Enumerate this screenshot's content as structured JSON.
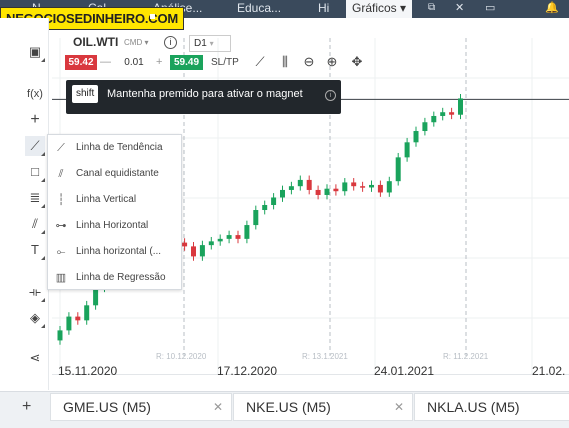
{
  "brand": {
    "logo_text": "NEGOCIOSEDINHEIRO.COM"
  },
  "nav": {
    "tabs": [
      {
        "label": "N"
      },
      {
        "label": "Cal"
      },
      {
        "label": "Análise..."
      },
      {
        "label": "Educa..."
      },
      {
        "label": "Hi"
      },
      {
        "label": "Gráficos"
      }
    ],
    "active": "Gráficos"
  },
  "instrument": {
    "symbol": "OIL.WTI",
    "type": "CMD",
    "interval": "D1",
    "sell_price": "59.42",
    "quantity": "0.01",
    "buy_price": "59.49",
    "sltp_label": "SL/TP",
    "minus": "—",
    "plus": "+"
  },
  "tooltip": {
    "key": "shift",
    "text": "Mantenha premido para ativar o magnet"
  },
  "left_toolbar": {
    "fx_label": "f(x)"
  },
  "drawing_menu": {
    "items": [
      {
        "label": "Linha de Tendência",
        "icon": "trendline-icon"
      },
      {
        "label": "Canal equidistante",
        "icon": "channel-icon"
      },
      {
        "label": "Linha Vertical",
        "icon": "vertical-line-icon"
      },
      {
        "label": "Linha Horizontal",
        "icon": "horizontal-line-icon"
      },
      {
        "label": "Linha horizontal (...",
        "icon": "horizontal-ray-icon"
      },
      {
        "label": "Linha de Regressão",
        "icon": "regression-icon"
      }
    ]
  },
  "chart_data": {
    "type": "candlestick",
    "x_tick_labels": [
      "15.11.2020",
      "17.12.2020",
      "24.01.2021",
      "21.02."
    ],
    "rollover_labels": [
      "R: 10.12.2020",
      "R: 13.1.2021",
      "R: 11.2.2021"
    ],
    "candles": [
      {
        "o": 40.2,
        "c": 41.0
      },
      {
        "o": 41.0,
        "c": 42.1
      },
      {
        "o": 42.1,
        "c": 41.8
      },
      {
        "o": 41.8,
        "c": 43.0
      },
      {
        "o": 43.0,
        "c": 44.4
      },
      {
        "o": 44.4,
        "c": 45.2
      },
      {
        "o": 45.2,
        "c": 45.0
      },
      {
        "o": 45.0,
        "c": 45.6
      },
      {
        "o": 45.6,
        "c": 46.3
      },
      {
        "o": 46.3,
        "c": 47.2
      },
      {
        "o": 47.2,
        "c": 46.6
      },
      {
        "o": 46.6,
        "c": 46.2
      },
      {
        "o": 46.2,
        "c": 47.4
      },
      {
        "o": 47.4,
        "c": 48.0
      },
      {
        "o": 48.0,
        "c": 47.7
      },
      {
        "o": 47.7,
        "c": 46.9
      },
      {
        "o": 46.9,
        "c": 47.8
      },
      {
        "o": 47.8,
        "c": 48.1
      },
      {
        "o": 48.1,
        "c": 48.3
      },
      {
        "o": 48.3,
        "c": 48.6
      },
      {
        "o": 48.6,
        "c": 48.3
      },
      {
        "o": 48.3,
        "c": 49.4
      },
      {
        "o": 49.4,
        "c": 50.6
      },
      {
        "o": 50.6,
        "c": 51.0
      },
      {
        "o": 51.0,
        "c": 51.6
      },
      {
        "o": 51.6,
        "c": 52.2
      },
      {
        "o": 52.2,
        "c": 52.5
      },
      {
        "o": 52.5,
        "c": 53.0
      },
      {
        "o": 53.0,
        "c": 52.2
      },
      {
        "o": 52.2,
        "c": 51.8
      },
      {
        "o": 51.8,
        "c": 52.3
      },
      {
        "o": 52.3,
        "c": 52.1
      },
      {
        "o": 52.1,
        "c": 52.8
      },
      {
        "o": 52.8,
        "c": 52.5
      },
      {
        "o": 52.5,
        "c": 52.4
      },
      {
        "o": 52.4,
        "c": 52.6
      },
      {
        "o": 52.6,
        "c": 52.0
      },
      {
        "o": 52.0,
        "c": 52.9
      },
      {
        "o": 52.9,
        "c": 54.8
      },
      {
        "o": 54.8,
        "c": 56.0
      },
      {
        "o": 56.0,
        "c": 56.9
      },
      {
        "o": 56.9,
        "c": 57.6
      },
      {
        "o": 57.6,
        "c": 58.1
      },
      {
        "o": 58.1,
        "c": 58.4
      },
      {
        "o": 58.4,
        "c": 58.2
      },
      {
        "o": 58.2,
        "c": 59.5
      }
    ],
    "current_price": 59.42,
    "ylim": [
      38,
      64
    ],
    "grid": true
  },
  "bottom_tabs": [
    {
      "name": "GME.US (M5)"
    },
    {
      "name": "NKE.US (M5)"
    },
    {
      "name": "NKLA.US (M5)"
    }
  ],
  "colors": {
    "up": "#1aa35c",
    "down": "#d9383e",
    "sell": "#d9383e",
    "buy": "#1aa35c",
    "tooltip_bg": "#22272c"
  }
}
